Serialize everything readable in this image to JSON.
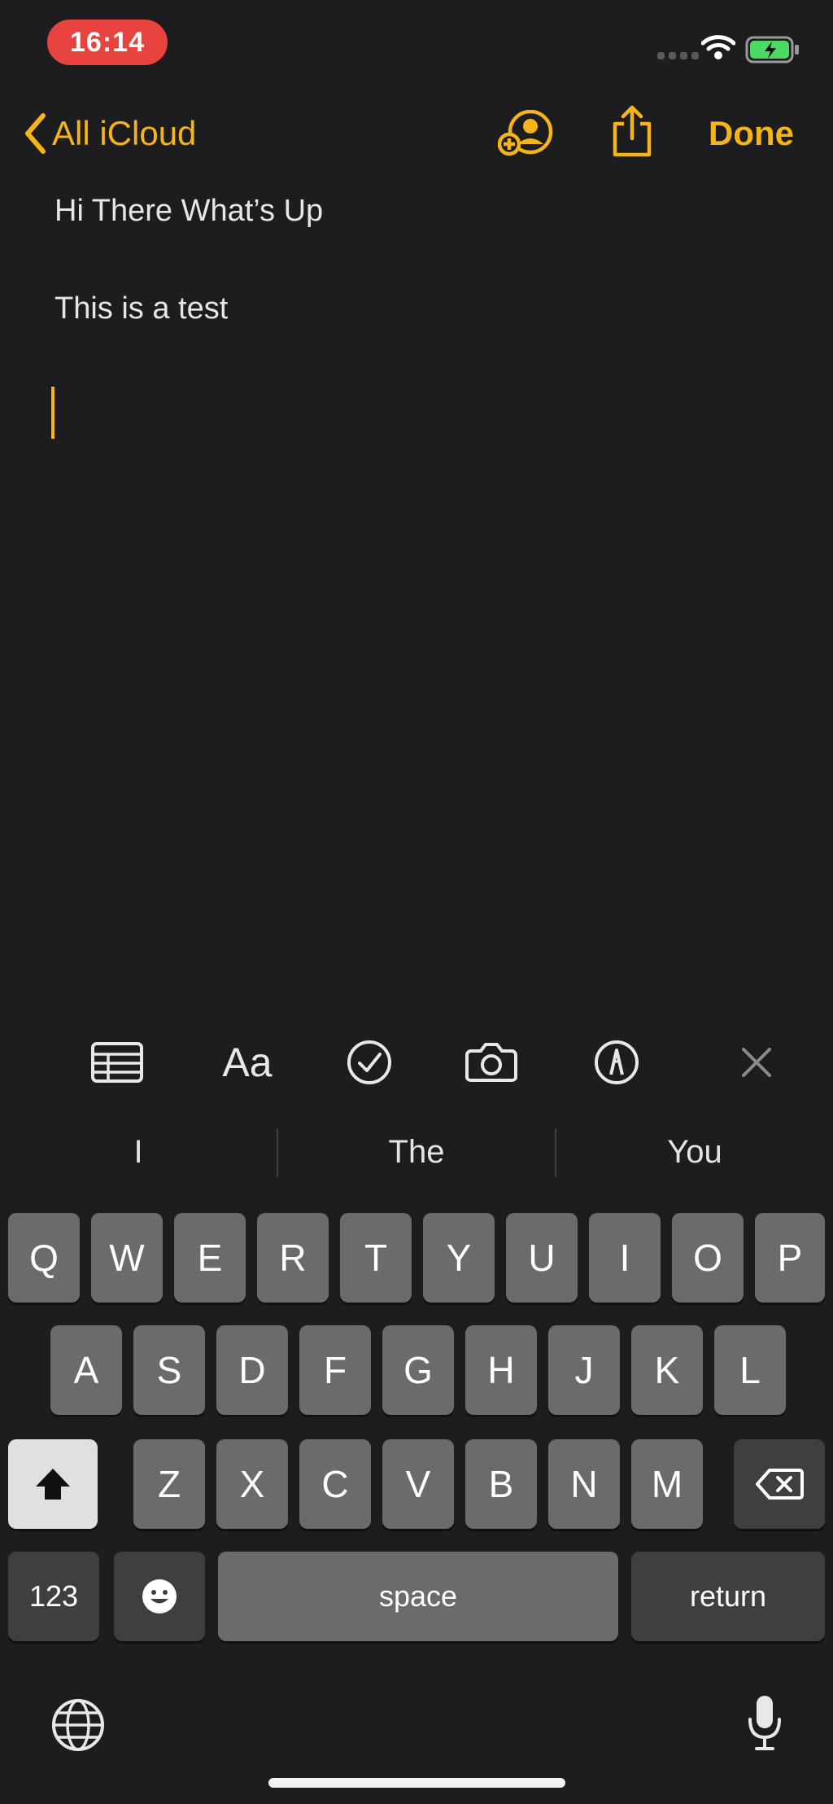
{
  "status_bar": {
    "time": "16:14"
  },
  "nav": {
    "back_label": "All iCloud",
    "done_label": "Done"
  },
  "note": {
    "lines": [
      "Hi There What’s Up",
      "This is a test"
    ]
  },
  "toolbar": {
    "format_label": "Aa"
  },
  "predictions": [
    "I",
    "The",
    "You"
  ],
  "keyboard": {
    "row1": [
      "Q",
      "W",
      "E",
      "R",
      "T",
      "Y",
      "U",
      "I",
      "O",
      "P"
    ],
    "row2": [
      "A",
      "S",
      "D",
      "F",
      "G",
      "H",
      "J",
      "K",
      "L"
    ],
    "row3": [
      "Z",
      "X",
      "C",
      "V",
      "B",
      "N",
      "M"
    ],
    "numbers_label": "123",
    "space_label": "space",
    "return_label": "return"
  },
  "colors": {
    "accent": "#f5b418",
    "background": "#1d1c1e",
    "key": "#6b6b6e",
    "key_dark": "#3f3f42",
    "time_pill": "#e8433f"
  },
  "icons": [
    "chevron-left-icon",
    "add-person-icon",
    "share-icon",
    "table-icon",
    "checklist-icon",
    "camera-icon",
    "markup-pen-icon",
    "close-icon",
    "shift-icon",
    "backspace-icon",
    "emoji-icon",
    "globe-icon",
    "microphone-icon",
    "wifi-icon",
    "battery-charging-icon"
  ]
}
